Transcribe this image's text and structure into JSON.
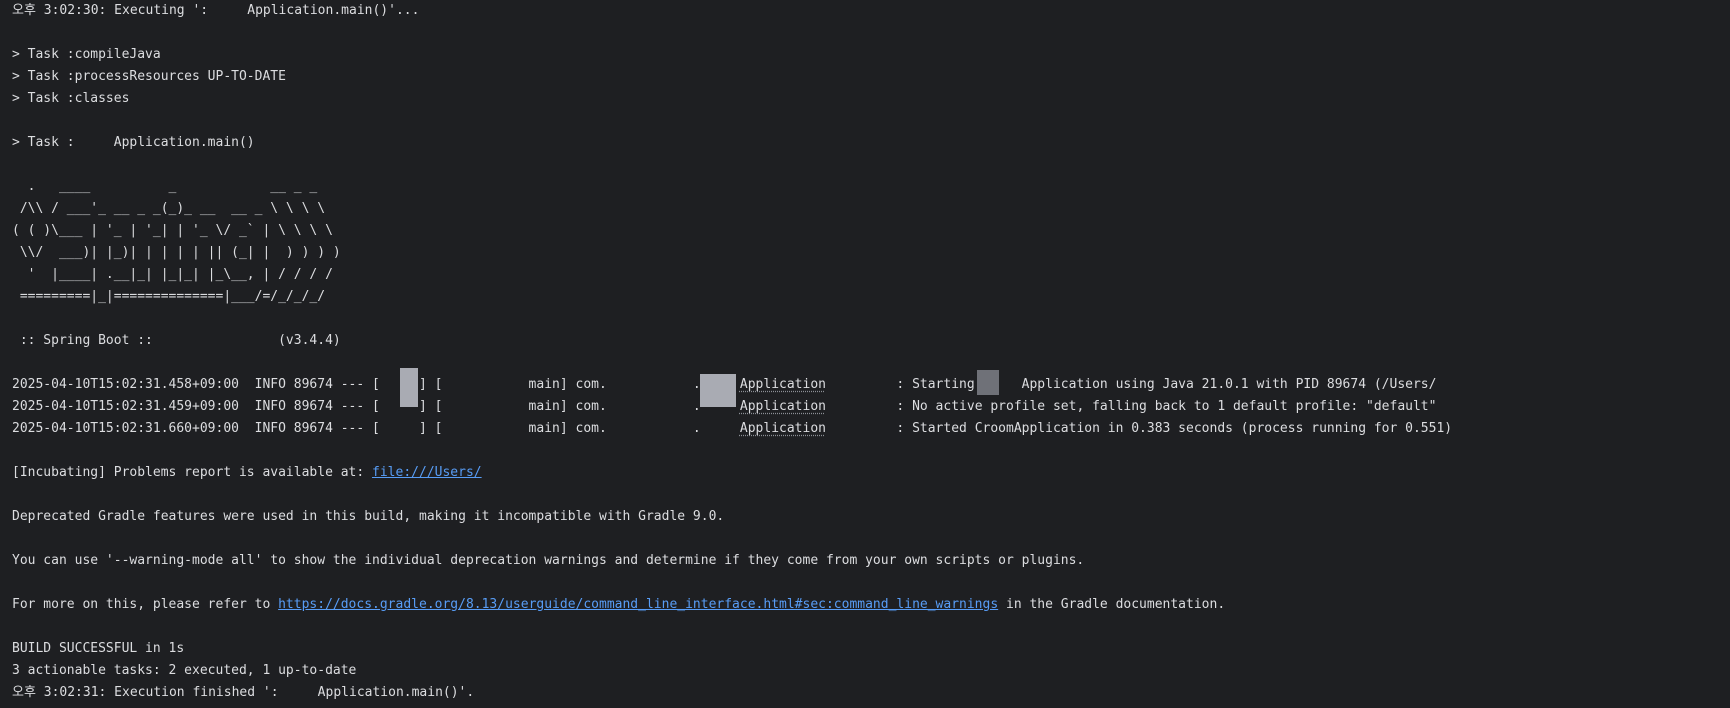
{
  "header": "오후 3:02:30: Executing ':     Application.main()'...",
  "tasks": [
    "> Task :compileJava",
    "> Task :processResources UP-TO-DATE",
    "> Task :classes"
  ],
  "task_main": "> Task :     Application.main()",
  "banner": [
    "  .   ____          _            __ _ _",
    " /\\\\ / ___'_ __ _ _(_)_ __  __ _ \\ \\ \\ \\",
    "( ( )\\___ | '_ | '_| | '_ \\/ _` | \\ \\ \\ \\",
    " \\\\/  ___)| |_)| | | | | || (_| |  ) ) ) )",
    "  '  |____| .__|_| |_|_| |_\\__, | / / / /",
    " =========|_|==============|___/=/_/_/_/"
  ],
  "spring_line": " :: Spring Boot ::                (v3.4.4)",
  "logs": [
    {
      "prefix": "2025-04-10T15:02:31.458+09:00  INFO 89674 --- [     ] [           main] com.           .     ",
      "class": "Application",
      "suffix": "         : Starting      Application using Java 21.0.1 with PID 89674 (/Users/"
    },
    {
      "prefix": "2025-04-10T15:02:31.459+09:00  INFO 89674 --- [     ] [           main] com.           .     ",
      "class": "Application",
      "suffix": "         : No active profile set, falling back to 1 default profile: \"default\""
    },
    {
      "prefix": "2025-04-10T15:02:31.660+09:00  INFO 89674 --- [     ] [           main] com.           .     ",
      "class": "Application",
      "suffix": "         : Started CroomApplication in 0.383 seconds (process running for 0.551)"
    }
  ],
  "problems": {
    "text": "[Incubating] Problems report is available at: ",
    "link": "file:///Users/"
  },
  "deprecated": "Deprecated Gradle features were used in this build, making it incompatible with Gradle 9.0.",
  "warning_mode": "You can use '--warning-mode all' to show the individual deprecation warnings and determine if they come from your own scripts or plugins.",
  "more_info": {
    "before": "For more on this, please refer to ",
    "link": "https://docs.gradle.org/8.13/userguide/command_line_interface.html#sec:command_line_warnings",
    "after": " in the Gradle documentation."
  },
  "build_result": "BUILD SUCCESSFUL in 1s",
  "actionable": "3 actionable tasks: 2 executed, 1 up-to-date",
  "footer": "오후 3:02:31: Execution finished ':     Application.main()'.",
  "colors": {
    "background": "#1e1f22",
    "text": "#dcdde0",
    "link": "#589df6"
  }
}
